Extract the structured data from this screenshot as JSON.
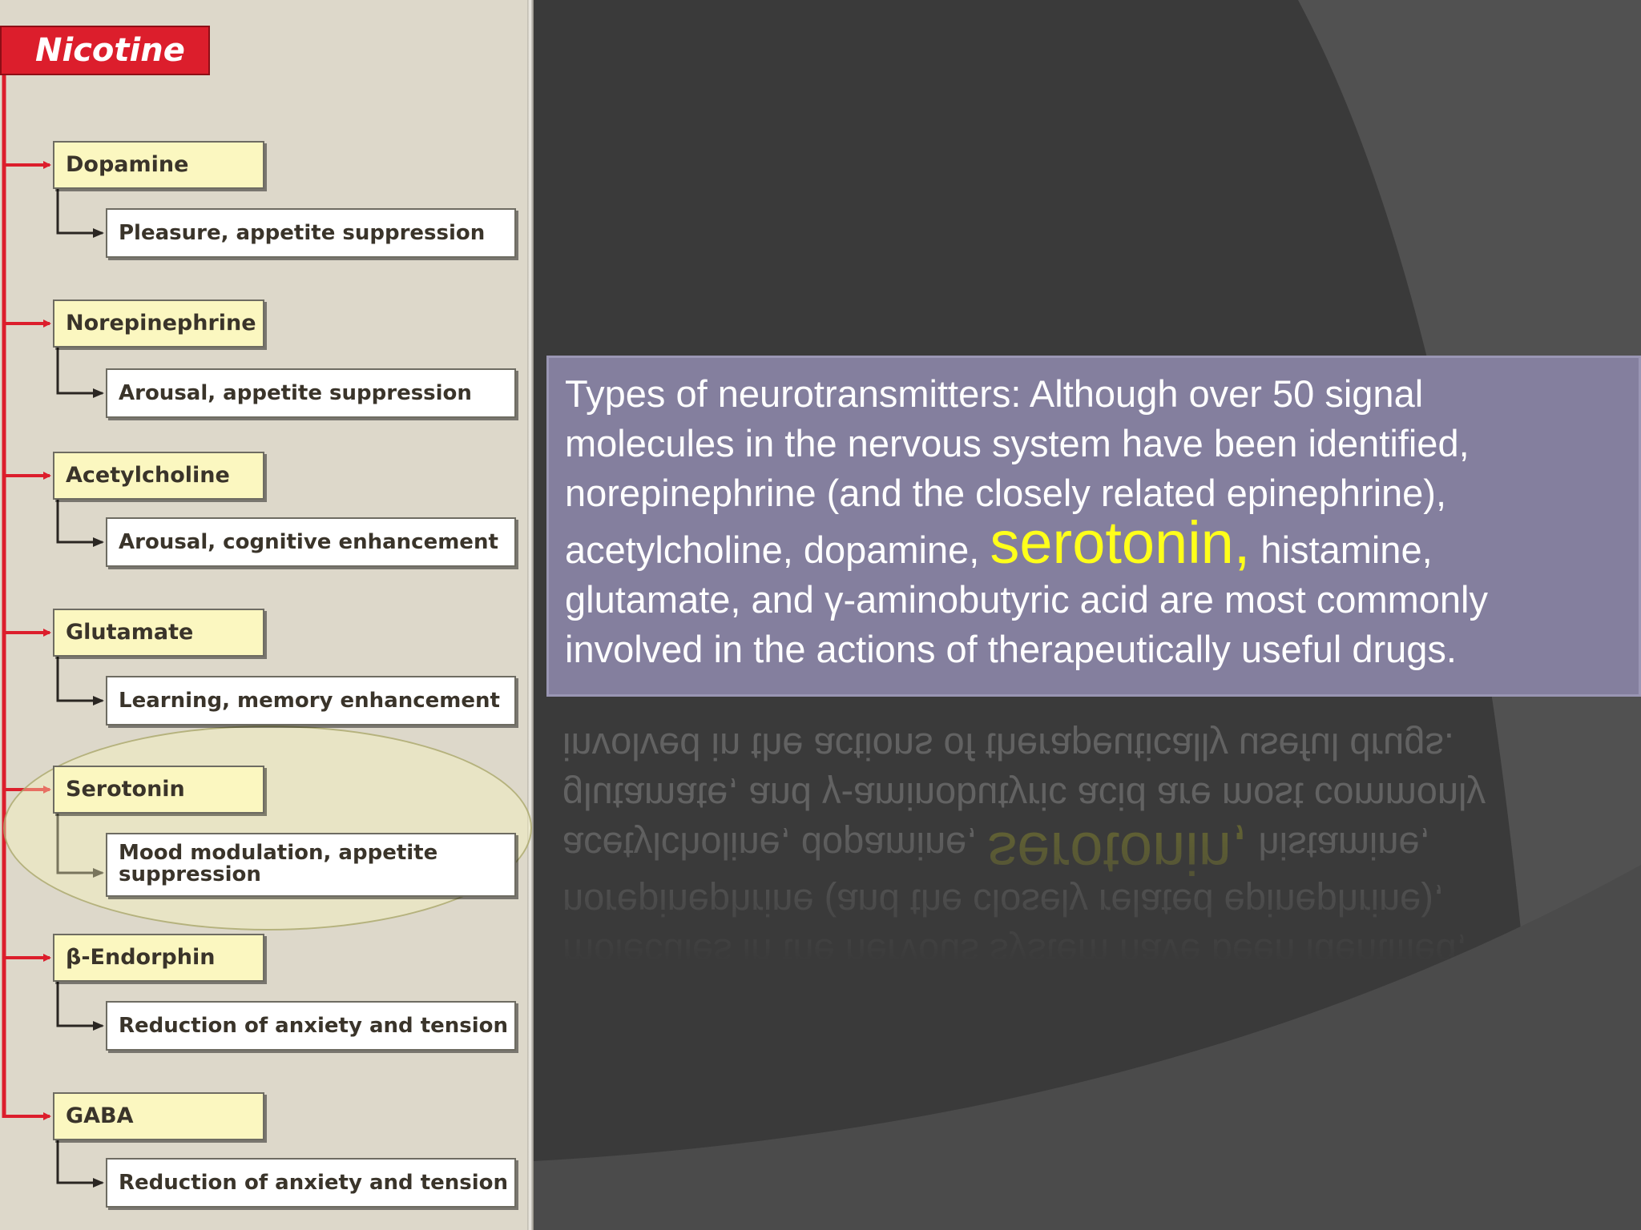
{
  "diagram": {
    "root": "Nicotine",
    "neurotransmitters": [
      {
        "name": "Dopamine",
        "effect": "Pleasure, appetite suppression"
      },
      {
        "name": "Norepinephrine",
        "effect": "Arousal, appetite suppression"
      },
      {
        "name": "Acetylcholine",
        "effect": "Arousal, cognitive enhancement"
      },
      {
        "name": "Glutamate",
        "effect": "Learning, memory enhancement"
      },
      {
        "name": "Serotonin",
        "effect": "Mood modulation, appetite suppression",
        "highlighted": true
      },
      {
        "name": "β-Endorphin",
        "effect": "Reduction of anxiety and tension"
      },
      {
        "name": "GABA",
        "effect": "Reduction of anxiety and tension"
      }
    ]
  },
  "text_panel": {
    "line1": "Types of neurotransmitters: Although over 50 signal",
    "line2": "molecules in the nervous system have been identified,",
    "line3": "norepinephrine (and the closely related epinephrine),",
    "line4_start": "acetylcholine, dopamine, ",
    "line4_highlight": "serotonin,",
    "line4_end": " histamine,",
    "line5": "glutamate, and γ-aminobutyric acid are most commonly",
    "line6": "involved in the actions of therapeutically useful drugs."
  },
  "colors": {
    "nicotine_red": "#dc1e2c",
    "neurotransmitter_box": "#fbf7c0",
    "effect_box": "#ffffff",
    "text_panel_bg": "#847f9e",
    "highlight_yellow": "#ffff1a"
  }
}
